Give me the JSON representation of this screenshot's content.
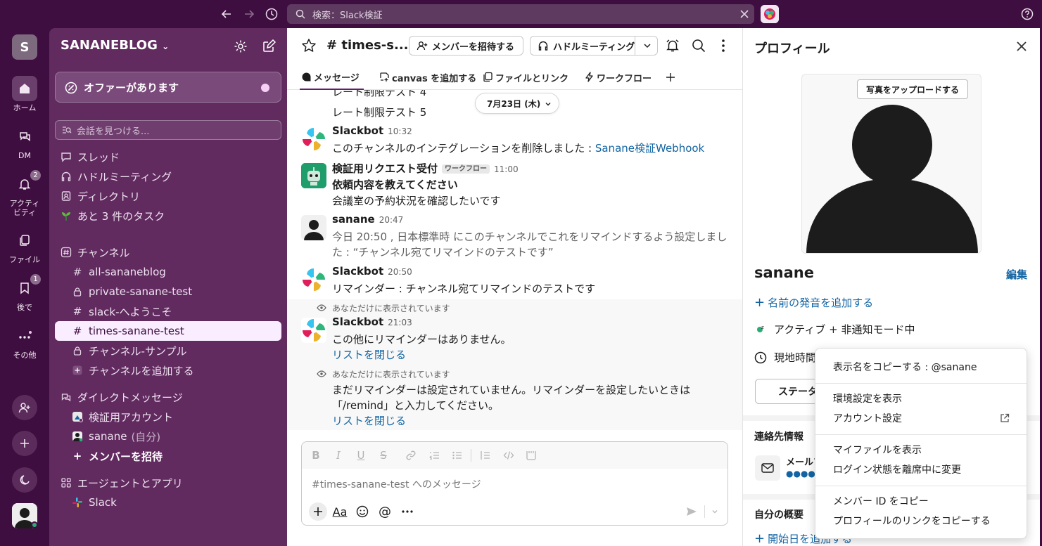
{
  "search": {
    "placeholder": "検索：Slack検証"
  },
  "rail": {
    "workspace_initial": "S",
    "home": "ホーム",
    "dm": "DM",
    "activity_line1": "アクティ",
    "activity_line2": "ビティ",
    "activity_badge": "2",
    "files": "ファイル",
    "later": "後で",
    "later_badge": "1",
    "more": "その他"
  },
  "sidebar": {
    "workspace": "SANANEBLOG",
    "offer": "オファーがあります",
    "find_placeholder": "会話を見つける...",
    "nav": [
      "スレッド",
      "ハドルミーティング",
      "ディレクトリ",
      "あと 3 件のタスク"
    ],
    "channels_header": "チャンネル",
    "channels": [
      "all-sananeblog",
      "private-sanane-test",
      "slack-へようこそ",
      "times-sanane-test",
      "チャンネル-サンプル"
    ],
    "add_channel": "チャンネルを追加する",
    "dm_header": "ダイレクトメッセージ",
    "dms": [
      "検証用アカウント",
      "sanane"
    ],
    "dm_self_suffix": "(自分)",
    "invite_members": "メンバーを招待",
    "agents_header": "エージェントとアプリ",
    "apps": [
      "Slack"
    ]
  },
  "channel": {
    "name": "# times-s...",
    "invite_button": "メンバーを招待する",
    "huddle_button": "ハドルミーティング",
    "tabs": [
      "メッセージ",
      "canvas を追加する",
      "ファイルとリンク",
      "ワークフロー"
    ],
    "date_pill": "7月23日 (木)"
  },
  "messages": {
    "rate1": "レート制限テスト 4",
    "rate2": "レート制限テスト 5",
    "m1": {
      "author": "Slackbot",
      "time": "10:32",
      "text": "このチャンネルのインテグレーションを削除しました : ",
      "link": "Sanane検証Webhook"
    },
    "m2": {
      "author": "検証用リクエスト受付",
      "tag": "ワークフロー",
      "time": "11:00",
      "bold": "依頼内容を教えてください",
      "text": "会議室の予約状況を確認したいです"
    },
    "m3": {
      "author": "sanane",
      "time": "20:47",
      "line1": "今日 20:50 , 日本標準時 にこのチャンネルでこれをリマインドするよう設定しまし",
      "line2": "た : “チャンネル宛てリマインドのテストです”"
    },
    "m4": {
      "author": "Slackbot",
      "time": "20:50",
      "text": "リマインダー : チャンネル宛てリマインドのテストです"
    },
    "only_you": "あなただけに表示されています",
    "m5": {
      "author": "Slackbot",
      "time": "21:03",
      "text": "この他にリマインダーはありません。",
      "link": "リストを閉じる"
    },
    "m6": {
      "line1": "まだリマインダーは設定されていません。リマインダーを設定したいときは",
      "line2": "「/remind」と入力してください。",
      "link": "リストを閉じる"
    }
  },
  "composer": {
    "placeholder": "#times-sanane-test へのメッセージ",
    "aa": "Aa"
  },
  "profile": {
    "title": "プロフィール",
    "upload": "写真をアップロードする",
    "name": "sanane",
    "edit": "編集",
    "add_pronunciation": "名前の発音を追加する",
    "status": "アクティブ + 非通知モード中",
    "local_time": "現地時間",
    "status_button": "ステータス",
    "contact_header": "連絡先情報",
    "email_label": "メールア",
    "email_value": "●●●●",
    "about_header": "自分の概要",
    "start_date": "開始日を追加する"
  },
  "menu": {
    "items": [
      "表示名をコピーする : @sanane",
      "環境設定を表示",
      "アカウント設定",
      "マイファイルを表示",
      "ログイン状態を離席中に変更",
      "メンバー ID をコピー",
      "プロフィールのリンクをコピーする"
    ]
  },
  "colors": {
    "aubergine": "#3f0e40",
    "sidebar": "#612b60",
    "link": "#1264a3",
    "active_channel": "#f9edff"
  }
}
